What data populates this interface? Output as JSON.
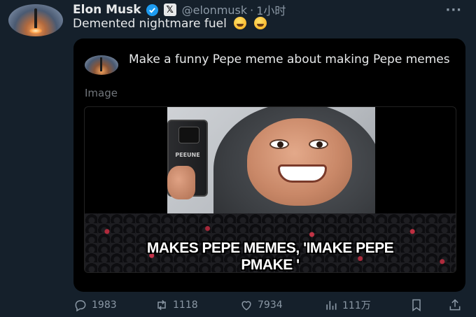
{
  "tweet": {
    "author_name": "Elon Musk",
    "handle": "@elonmusk",
    "separator": "·",
    "time": "1小时",
    "more_icon": "more-dots-icon",
    "text": "Demented nightmare fuel",
    "emoji_count": 2
  },
  "card": {
    "prompt": "Make a funny Pepe meme about making Pepe memes",
    "image_label": "Image",
    "meme": {
      "phone_brand": "PEEUNE",
      "caption_line1": "MAKES PEPE MEMES, 'IMAKE PEPE",
      "caption_line2": "PMAKE '"
    }
  },
  "actions": {
    "reply": "1983",
    "retweet": "1118",
    "like": "7934",
    "views": "111万"
  },
  "colors": {
    "background": "#15202b",
    "card_background": "#000000",
    "verified_blue": "#1d9bf0",
    "muted_text": "#8b98a5"
  }
}
